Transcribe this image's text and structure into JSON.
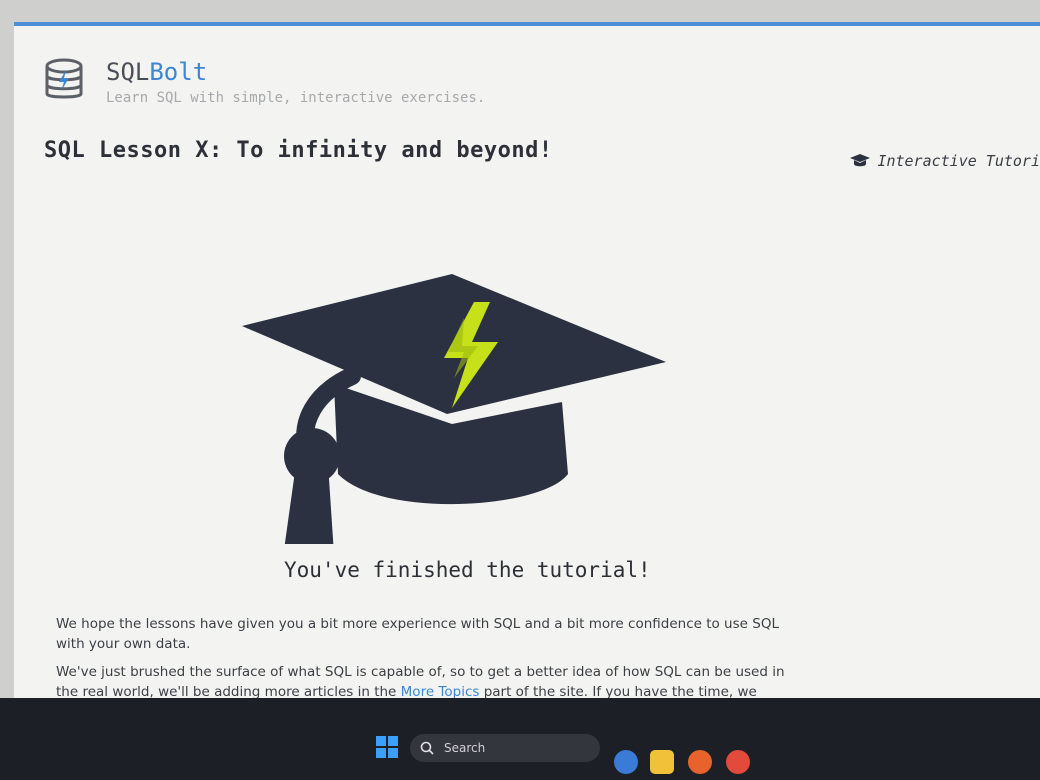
{
  "site": {
    "name_plain": "SQL",
    "name_accent": "Bolt",
    "tagline": "Learn SQL with simple, interactive exercises."
  },
  "lesson": {
    "title": "SQL Lesson X: To infinity and beyond!"
  },
  "nav": {
    "tutorial_link": "Interactive Tutori"
  },
  "content": {
    "finished_heading": "You've finished the tutorial!",
    "paragraph1": "We hope the lessons have given you a bit more experience with SQL and a bit more confidence to use SQL with your own data.",
    "paragraph2_before": "We've just brushed the surface of what SQL is capable of, so to get a better idea of how SQL can be used in the real world, we'll be adding more articles in the ",
    "paragraph2_link": "More Topics",
    "paragraph2_after": " part of the site. If you have the time, we"
  },
  "taskbar": {
    "search_placeholder": "Search"
  },
  "colors": {
    "accent": "#3d86d1",
    "cap": "#2b3140",
    "bolt": "#c6e11a"
  }
}
